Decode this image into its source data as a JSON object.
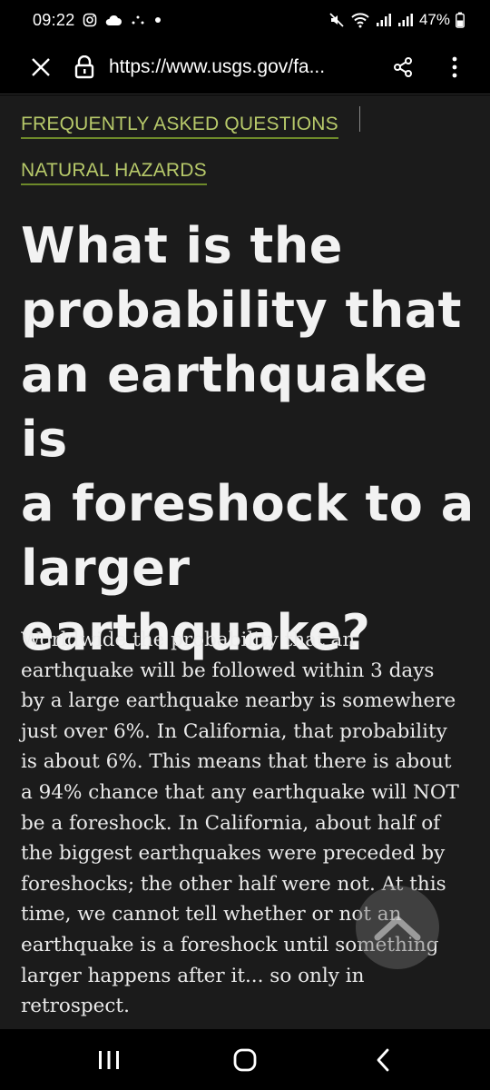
{
  "status_bar": {
    "time": "09:22",
    "battery_percent": "47%",
    "icons": [
      "instagram-icon",
      "cloud-icon",
      "dots-icon",
      "dot-icon",
      "mute-icon",
      "wifi-icon",
      "signal-icon",
      "signal-icon",
      "battery-icon"
    ]
  },
  "browser": {
    "url": "https://www.usgs.gov/fa..."
  },
  "breadcrumbs": [
    {
      "label": "FREQUENTLY ASKED QUESTIONS"
    },
    {
      "label": "NATURAL HAZARDS"
    }
  ],
  "article": {
    "title_lines": [
      "What is the",
      "probability that",
      "an earthquake is",
      "a foreshock to a",
      "larger",
      "earthquake?"
    ],
    "body_lines": [
      "Worldwide the probability that an",
      "earthquake will be followed within 3 days",
      "by a large earthquake nearby is somewhere",
      "just over 6%. In California, that probability",
      "is about 6%. This means that there is about",
      "a 94% chance that any earthquake will NOT",
      "be a foreshock. In California, about half of",
      "the biggest earthquakes were preceded by",
      "foreshocks; the other half were not. At this",
      "time, we cannot tell whether or not an",
      "earthquake is a foreshock until something",
      "larger happens after it... so only in",
      "retrospect."
    ]
  },
  "colors": {
    "content_bg": "#1b1b1b",
    "breadcrumb_text": "#b7c96a",
    "breadcrumb_underline": "#6e8a2a"
  }
}
